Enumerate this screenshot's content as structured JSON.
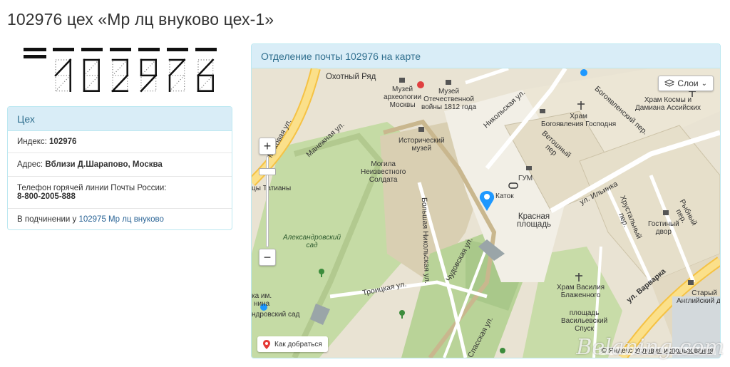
{
  "page": {
    "title": "102976 цех «Мр лц внуково цех-1»"
  },
  "index_code": {
    "digits": "102976"
  },
  "info_panel": {
    "heading": "Цех",
    "index_label": "Индекс:",
    "index_value": "102976",
    "address_label": "Адрес:",
    "address_value": "Вблизи Д.Шарапово, Москва",
    "phone_label": "Телефон горячей линии Почты России:",
    "phone_value": "8-800-2005-888",
    "parent_label": "В подчинении у",
    "parent_link": "102975 Мр лц внуково"
  },
  "map_panel": {
    "heading": "Отделение почты 102976 на карте",
    "layers_label": "Слои",
    "route_label": "Как добраться",
    "copyright_prefix": "© Яндекс",
    "terms_link": "Условия использования",
    "labels": {
      "okhotny": "Охотный Ряд",
      "museum_arch": "Музей\nархеологии\nМосквы",
      "museum_war": "Музей\nОтечественной\nвойны 1812 года",
      "nikolskaya": "Никольская ул.",
      "bogoyavl": "Богоявленский пер.",
      "khram_kosmy": "Храм Космы и\nДамиана Ассийских",
      "khram_bogoyavl": "Храм\nБогоявления Господня",
      "mokhovaya": "Моховая ул.",
      "manezhnaya": "Манежная ул.",
      "istorich": "Исторический\nмузей",
      "vetoshny": "Ветошный\nпер",
      "gum": "ГУМ",
      "mogila": "Могила\nНеизвестного\nСолдата",
      "tatiany": "цы Татианы",
      "katok": "Каток",
      "ilyinka": "ул. Ильинка",
      "khrustalny": "Хрустальный\nпер.",
      "rybny": "Рыбный\nпер.",
      "krasnaya": "Красная\nплощадь",
      "gostiny": "Гостиный\nдвор",
      "bolshaya_nik": "Большая Никольская ул.",
      "alexandr": "Александровский\nсад",
      "chudovskaya": "Чудовская ул.",
      "varvarka": "ул. Варварка",
      "khram_vasiliya": "Храм Василия\nБлаженного",
      "stary_dvor": "Старый\nАнглийский двор",
      "troitskaya": "Троицкая ул.",
      "vasilevsky": "площадь\nВасильевский\nСпуск",
      "spasskaya": "Спасская ул.",
      "aleks_sad_metro": "ндровский сад",
      "lenina": "ка им.\nнина"
    }
  },
  "watermark": "Belaning.com",
  "colors": {
    "panel_head_bg": "#d9edf7",
    "panel_head_text": "#31708f",
    "panel_border": "#bce8f1",
    "link": "#2a6496",
    "map_pin": "#1e98ff"
  }
}
